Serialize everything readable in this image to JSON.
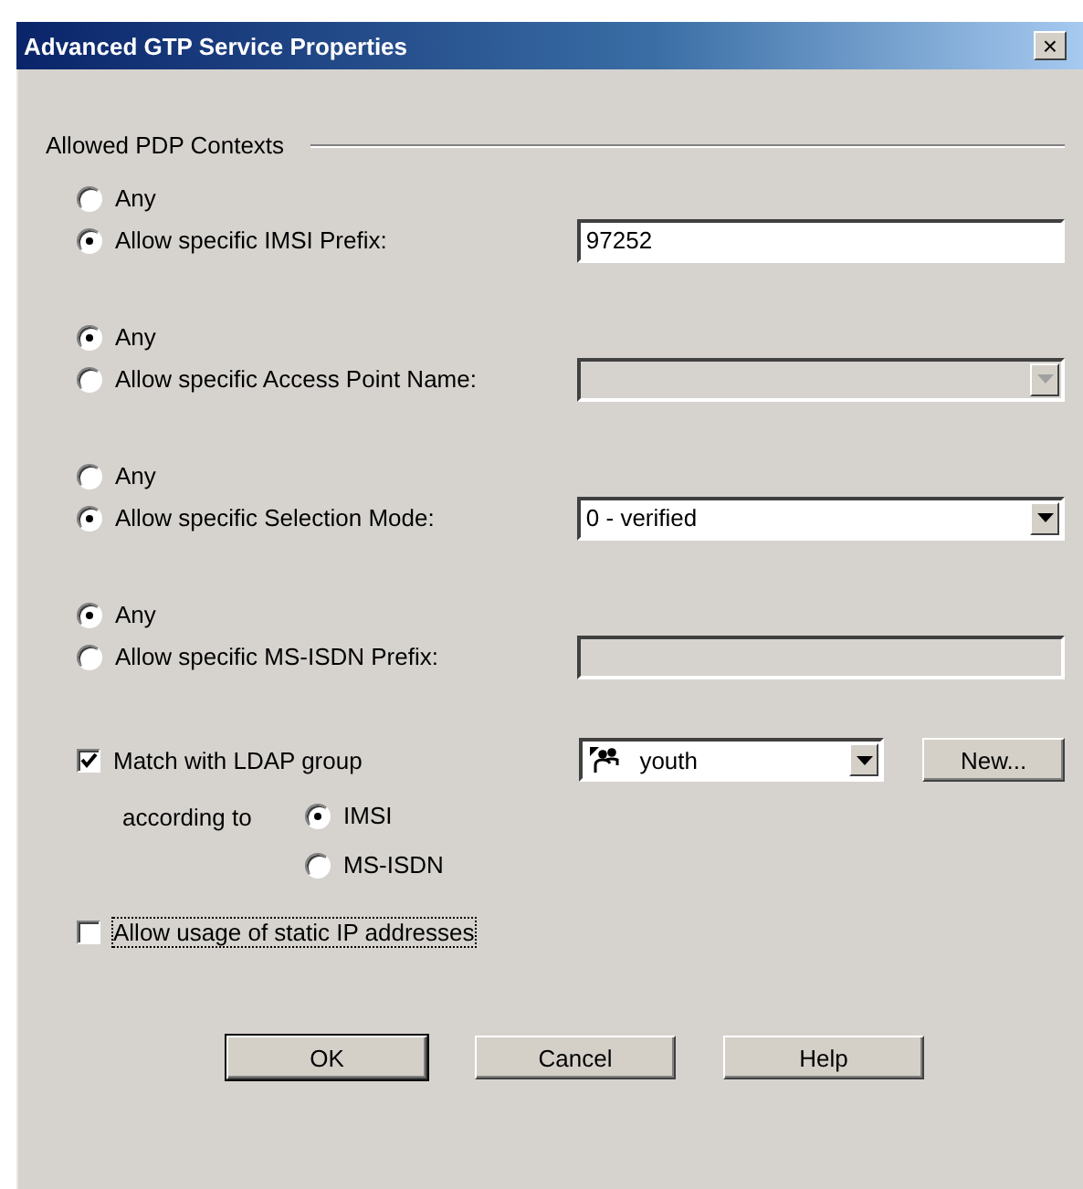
{
  "window": {
    "title": "Advanced GTP Service Properties",
    "close": "×"
  },
  "group": {
    "label": "Allowed PDP Contexts"
  },
  "filters": [
    {
      "options": [
        {
          "label": "Any",
          "selected": false
        },
        {
          "label": "Allow specific IMSI Prefix:",
          "selected": true
        }
      ],
      "field": {
        "kind": "text",
        "value": "97252",
        "disabled": false
      }
    },
    {
      "options": [
        {
          "label": "Any",
          "selected": true
        },
        {
          "label": "Allow specific Access Point Name:",
          "selected": false
        }
      ],
      "field": {
        "kind": "combo",
        "disabled": true
      }
    },
    {
      "options": [
        {
          "label": "Any",
          "selected": false
        },
        {
          "label": "Allow specific Selection Mode:",
          "selected": true
        }
      ],
      "field": {
        "kind": "combo",
        "value": "0 - verified",
        "disabled": false
      }
    },
    {
      "options": [
        {
          "label": "Any",
          "selected": true
        },
        {
          "label": "Allow specific MS-ISDN Prefix:",
          "selected": false
        }
      ],
      "field": {
        "kind": "text",
        "disabled": true
      }
    }
  ],
  "ldap": {
    "label": "Match with LDAP group",
    "checked": true,
    "group_value": "youth",
    "new_button": "New...",
    "according_label": "according to",
    "options": [
      {
        "label": "IMSI",
        "selected": true
      },
      {
        "label": "MS-ISDN",
        "selected": false
      }
    ]
  },
  "static_ip": {
    "label": "Allow usage of static IP addresses",
    "checked": false,
    "focused": true
  },
  "buttons": [
    {
      "label": "OK",
      "default": true
    },
    {
      "label": "Cancel",
      "default": false
    },
    {
      "label": "Help",
      "default": false
    }
  ]
}
